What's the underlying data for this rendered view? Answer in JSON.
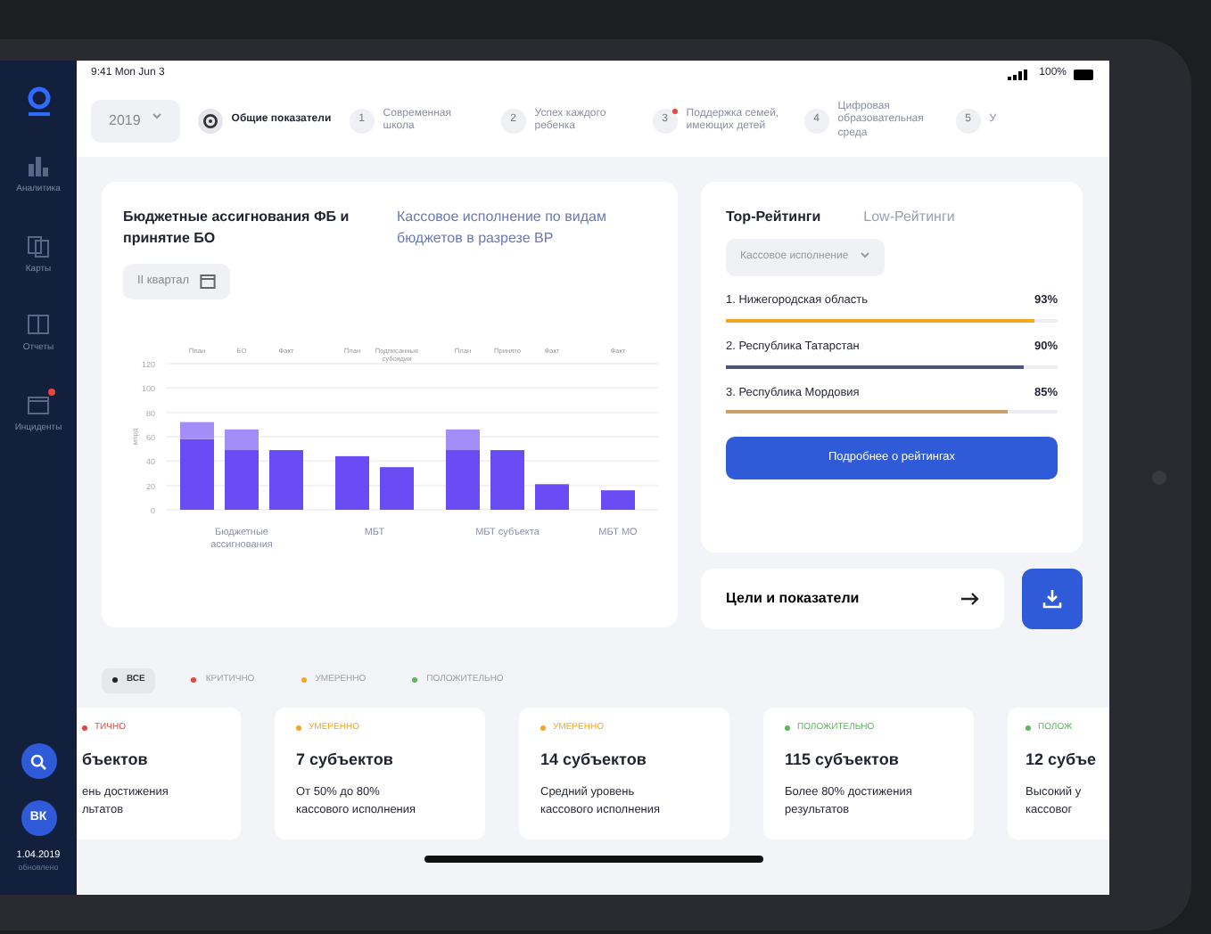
{
  "status_bar": {
    "time": "9:41 Mon Jun 3",
    "battery": "100%"
  },
  "sidebar": {
    "items": [
      {
        "label": "Аналитика",
        "kind": "chart",
        "alert": false
      },
      {
        "label": "Карты",
        "kind": "map",
        "alert": false
      },
      {
        "label": "Отчеты",
        "kind": "report",
        "alert": false
      },
      {
        "label": "Инциденты",
        "kind": "calendar",
        "alert": true
      }
    ],
    "avatar": "ВК",
    "date": "1.04.2019",
    "date_caption": "обновлено"
  },
  "year": "2019",
  "steps": [
    {
      "kind": "overview",
      "label": "Общие показатели",
      "selected": true,
      "alert": false
    },
    {
      "kind": "numbered",
      "number": "1",
      "label": "Современная школа",
      "selected": false,
      "alert": false
    },
    {
      "kind": "numbered",
      "number": "2",
      "label": "Успех каждого ребенка",
      "selected": false,
      "alert": false
    },
    {
      "kind": "numbered",
      "number": "3",
      "label": "Поддержка семей, имеющих детей",
      "selected": false,
      "alert": true
    },
    {
      "kind": "numbered",
      "number": "4",
      "label": "Цифровая образовательная среда",
      "selected": false,
      "alert": false
    },
    {
      "kind": "numbered",
      "number": "5",
      "label": "У",
      "selected": false,
      "alert": false
    }
  ],
  "budget": {
    "tabs": [
      {
        "label": "Бюджетные ассигнования ФБ и принятие БО",
        "selected": true
      },
      {
        "label": "Кассовое исполнение по видам бюджетов в разрезе ВР",
        "selected": false
      }
    ],
    "period": "II квартал",
    "x_groups": [
      "Бюджетные ассигнования",
      "МБТ",
      "МБТ субъекта",
      "МБТ МО"
    ],
    "chart_data": {
      "type": "bar",
      "ylabel": "млрд",
      "stacked": true,
      "grid": true,
      "categories": [
        "План",
        "БО",
        "Факт",
        null,
        "План",
        "Подписанные субсидии",
        null,
        "План",
        "Принято",
        "Факт",
        null,
        "Факт"
      ],
      "series": [
        {
          "color": "#6a4cf5",
          "values": [
            58,
            49,
            49,
            null,
            44,
            35,
            null,
            49,
            49,
            21,
            null,
            16
          ]
        },
        {
          "color": "#a38ef8",
          "values": [
            14,
            17,
            0,
            null,
            0,
            0,
            null,
            17,
            0,
            0,
            null,
            0
          ]
        }
      ],
      "ylim": [
        0,
        120
      ],
      "yticks": [
        0,
        20,
        40,
        60,
        80,
        100,
        120
      ]
    }
  },
  "ratings": {
    "tabs": [
      {
        "label": "Top-Рейтинги",
        "selected": true
      },
      {
        "label": "Low-Рейтинги",
        "selected": false
      }
    ],
    "filter": "Кассовое исполнение",
    "items": [
      {
        "name": "1. Нижегородская область",
        "value": "93%",
        "level": 0.93,
        "color": "#f5a623"
      },
      {
        "name": "2. Республика Татарстан",
        "value": "90%",
        "level": 0.9,
        "color": "#4a5578"
      },
      {
        "name": "3. Республика Мордовия",
        "value": "85%",
        "level": 0.85,
        "color": "#c8a06a"
      }
    ],
    "button": "Подробнее о рейтингах"
  },
  "goals": {
    "label": "Цели и показатели"
  },
  "filters": [
    {
      "label": "ВСЕ",
      "color": "#222222",
      "selected": true
    },
    {
      "label": "КРИТИЧНО",
      "color": "#e8453c",
      "selected": false
    },
    {
      "label": "УМЕРЕННО",
      "color": "#f5a623",
      "selected": false
    },
    {
      "label": "ПОЛОЖИТЕЛЬНО",
      "color": "#5cb85c",
      "selected": false
    }
  ],
  "cards": [
    {
      "status": "ТИЧНО",
      "color": "#e8453c",
      "title": "бъектов",
      "lines": [
        "ень достижения",
        "льтатов"
      ]
    },
    {
      "status": "УМЕРЕННО",
      "color": "#f5a623",
      "title": "7 субъектов",
      "lines": [
        "От 50% до 80%",
        "кассового исполнения"
      ]
    },
    {
      "status": "УМЕРЕННО",
      "color": "#f5a623",
      "title": "14 субъектов",
      "lines": [
        "Средний уровень",
        "кассового исполнения"
      ]
    },
    {
      "status": "ПОЛОЖИТЕЛЬНО",
      "color": "#5cb85c",
      "title": "115 субъектов",
      "lines": [
        "Более 80% достижения",
        "результатов"
      ]
    },
    {
      "status": "ПОЛОЖ",
      "color": "#5cb85c",
      "title": "12 субъе",
      "lines": [
        "Высокий у",
        "кассовог"
      ]
    }
  ]
}
